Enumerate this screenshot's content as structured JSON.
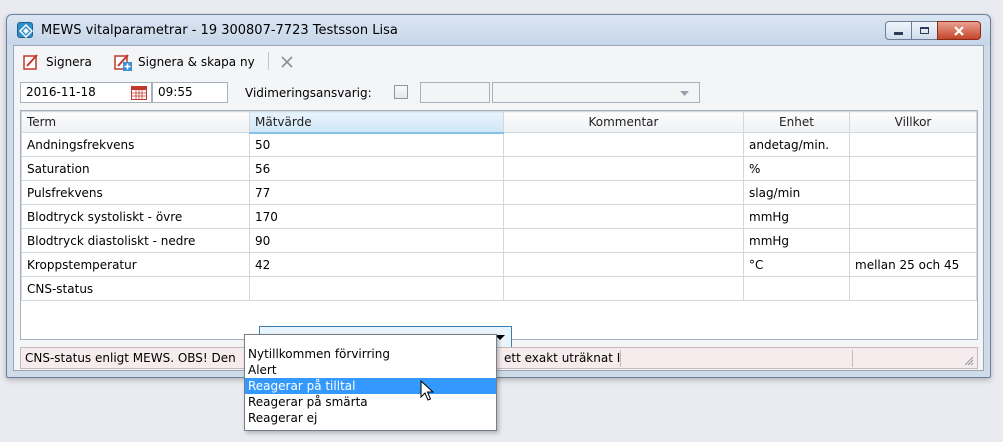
{
  "window": {
    "title": "MEWS vitalparametrar -  19 300807-7723 Testsson Lisa"
  },
  "toolbar": {
    "sign_label": "Signera",
    "sign_new_label": "Signera & skapa ny"
  },
  "datebar": {
    "date": "2016-11-18",
    "time": "09:55",
    "verifier_label": "Vidimeringsansvarig:"
  },
  "table": {
    "columns": [
      "Term",
      "Mätvärde",
      "Kommentar",
      "Enhet",
      "Villkor"
    ],
    "rows": [
      {
        "term": "Andningsfrekvens",
        "value": "50",
        "comment": "",
        "unit": "andetag/min.",
        "condition": ""
      },
      {
        "term": "Saturation",
        "value": "56",
        "comment": "",
        "unit": "%",
        "condition": ""
      },
      {
        "term": "Pulsfrekvens",
        "value": "77",
        "comment": "",
        "unit": "slag/min",
        "condition": ""
      },
      {
        "term": "Blodtryck systoliskt - övre",
        "value": "170",
        "comment": "",
        "unit": "mmHg",
        "condition": ""
      },
      {
        "term": "Blodtryck diastoliskt - nedre",
        "value": "90",
        "comment": "",
        "unit": "mmHg",
        "condition": ""
      },
      {
        "term": "Kroppstemperatur",
        "value": "42",
        "comment": "",
        "unit": "°C",
        "condition": "mellan 25 och 45"
      },
      {
        "term": "CNS-status",
        "value": "",
        "comment": "",
        "unit": "",
        "condition": ""
      }
    ]
  },
  "status": {
    "text_left": "CNS-status enligt MEWS. OBS! Den",
    "text_right": "ett exakt uträknat I"
  },
  "dropdown": {
    "options": [
      "Nytillkommen förvirring",
      "Alert",
      "Reagerar på tilltal",
      "Reagerar på smärta",
      "Reagerar ej"
    ],
    "highlighted": "Reagerar på tilltal"
  },
  "colors": {
    "highlight": "#3399ff",
    "status_bg": "#f7eced",
    "close_button": "#c4452b"
  }
}
